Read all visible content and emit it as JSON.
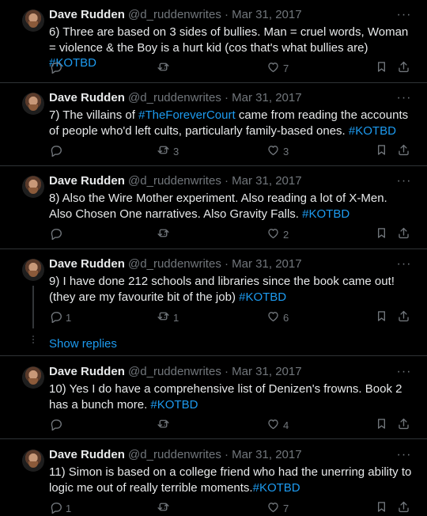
{
  "tweets": [
    {
      "name": "Dave Rudden",
      "handle": "@d_ruddenwrites",
      "sep": "·",
      "date": "Mar 31, 2017",
      "text_parts": [
        {
          "t": "6) Three are based on 3 sides of bullies. Man = cruel words, Woman = violence & the Boy is a hurt kid (cos that's what bullies are) "
        },
        {
          "t": "#KOTBD",
          "link": true
        }
      ],
      "replies": "",
      "retweets": "",
      "likes": "7"
    },
    {
      "name": "Dave Rudden",
      "handle": "@d_ruddenwrites",
      "sep": "·",
      "date": "Mar 31, 2017",
      "text_parts": [
        {
          "t": "7) The villains of "
        },
        {
          "t": "#TheForeverCourt",
          "link": true
        },
        {
          "t": " came from reading the accounts of people who'd left cults, particularly family-based ones. "
        },
        {
          "t": "#KOTBD",
          "link": true
        }
      ],
      "replies": "",
      "retweets": "3",
      "likes": "3"
    },
    {
      "name": "Dave Rudden",
      "handle": "@d_ruddenwrites",
      "sep": "·",
      "date": "Mar 31, 2017",
      "text_parts": [
        {
          "t": "8) Also the Wire Mother experiment. Also reading a lot of X-Men. Also Chosen One narratives. Also Gravity Falls. "
        },
        {
          "t": "#KOTBD",
          "link": true
        }
      ],
      "replies": "",
      "retweets": "",
      "likes": "2"
    },
    {
      "name": "Dave Rudden",
      "handle": "@d_ruddenwrites",
      "sep": "·",
      "date": "Mar 31, 2017",
      "text_parts": [
        {
          "t": "9) I have done 212 schools and libraries since the book came out! (they are my favourite bit of the job) "
        },
        {
          "t": "#KOTBD",
          "link": true
        }
      ],
      "replies": "1",
      "retweets": "1",
      "likes": "6"
    },
    {
      "name": "Dave Rudden",
      "handle": "@d_ruddenwrites",
      "sep": "·",
      "date": "Mar 31, 2017",
      "text_parts": [
        {
          "t": "10) Yes I do have a comprehensive list of Denizen's frowns. Book 2 has a bunch more. "
        },
        {
          "t": "#KOTBD",
          "link": true
        }
      ],
      "replies": "",
      "retweets": "",
      "likes": "4"
    },
    {
      "name": "Dave Rudden",
      "handle": "@d_ruddenwrites",
      "sep": "·",
      "date": "Mar 31, 2017",
      "text_parts": [
        {
          "t": "11) Simon is based on a college friend who had the unerring ability to logic me out of really terrible moments."
        },
        {
          "t": "#KOTBD",
          "link": true
        }
      ],
      "replies": "1",
      "retweets": "",
      "likes": "7"
    }
  ],
  "show_replies_label": "Show replies",
  "more_label": "···",
  "icons": {
    "reply": "reply-icon",
    "retweet": "retweet-icon",
    "like": "heart-icon",
    "bookmark": "bookmark-icon",
    "share": "share-icon"
  }
}
